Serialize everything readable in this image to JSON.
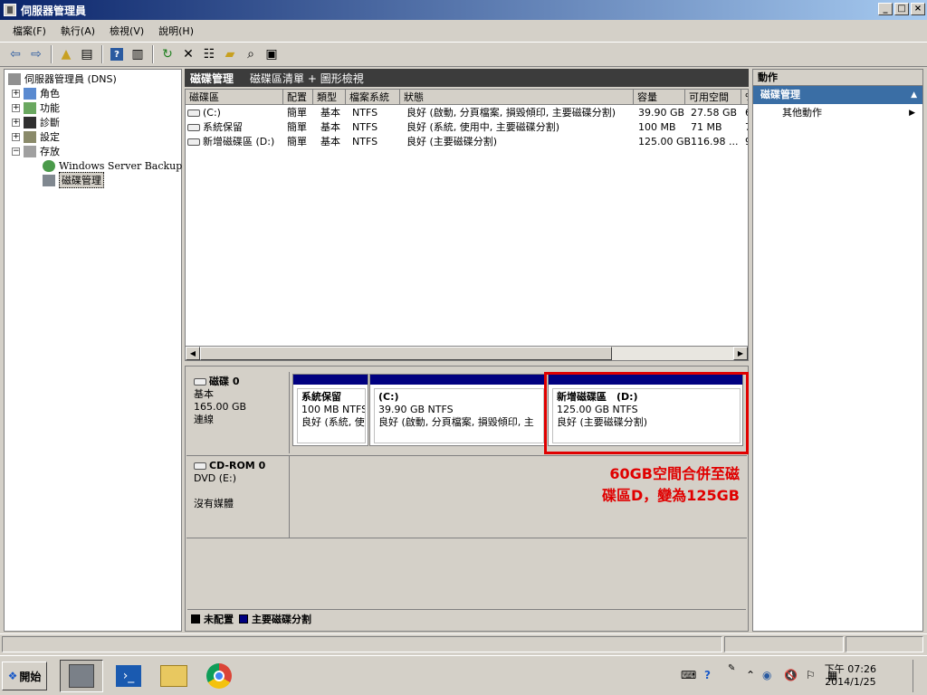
{
  "window": {
    "title": "伺服器管理員"
  },
  "menubar": [
    "檔案(F)",
    "執行(A)",
    "檢視(V)",
    "說明(H)"
  ],
  "toolbar_icons": [
    "back-icon",
    "forward-icon",
    "up-folder-icon",
    "show-hide-tree-icon",
    "help-icon",
    "show-hide-action-icon",
    "refresh-icon",
    "delete-icon",
    "properties-icon",
    "open-icon",
    "search-icon",
    "export-icon"
  ],
  "tree": {
    "root": "伺服器管理員 (DNS)",
    "items": [
      "角色",
      "功能",
      "診斷",
      "設定",
      "存放"
    ],
    "storage_children": [
      "Windows Server Backup",
      "磁碟管理"
    ]
  },
  "center": {
    "title": "磁碟管理",
    "view": "磁碟區清單 + 圖形檢視",
    "columns": [
      "磁碟區",
      "配置",
      "類型",
      "檔案系統",
      "狀態",
      "容量",
      "可用空間",
      "%"
    ],
    "rows": [
      [
        "(C:)",
        "簡單",
        "基本",
        "NTFS",
        "良好 (啟動, 分頁檔案, 損毀傾印, 主要磁碟分割)",
        "39.90 GB",
        "27.58 GB",
        "6"
      ],
      [
        "系統保留",
        "簡單",
        "基本",
        "NTFS",
        "良好 (系統, 使用中, 主要磁碟分割)",
        "100 MB",
        "71 MB",
        "7"
      ],
      [
        "新增磁碟區 (D:)",
        "簡單",
        "基本",
        "NTFS",
        "良好 (主要磁碟分割)",
        "125.00 GB",
        "116.98 ...",
        "9"
      ]
    ]
  },
  "disks": {
    "disk0": {
      "name": "磁碟 0",
      "type": "基本",
      "size": "165.00 GB",
      "status": "連線"
    },
    "cdrom": {
      "name": "CD-ROM 0",
      "drive": "DVD (E:)",
      "media": "沒有媒體"
    },
    "partitions": [
      {
        "name": "系統保留",
        "fs": "100 MB NTFS",
        "status": "良好 (系統, 使"
      },
      {
        "name": "(C:)",
        "fs": "39.90 GB NTFS",
        "status": "良好 (啟動, 分頁檔案, 損毀傾印, 主"
      },
      {
        "name": "新增磁碟區　(D:)",
        "fs": "125.00 GB NTFS",
        "status": "良好 (主要磁碟分割)"
      }
    ]
  },
  "annotation": {
    "line1": "60GB空間合併至磁",
    "line2": "碟區D，變為125GB",
    "color": "#e00000"
  },
  "legend": {
    "unallocated": "未配置",
    "primary": "主要磁碟分割",
    "unallocated_color": "#000000",
    "primary_color": "#000080"
  },
  "actions": {
    "header": "動作",
    "section": "磁碟管理",
    "item": "其他動作"
  },
  "taskbar": {
    "start": "開始",
    "clock_time": "下午 07:26",
    "clock_date": "2014/1/25"
  }
}
